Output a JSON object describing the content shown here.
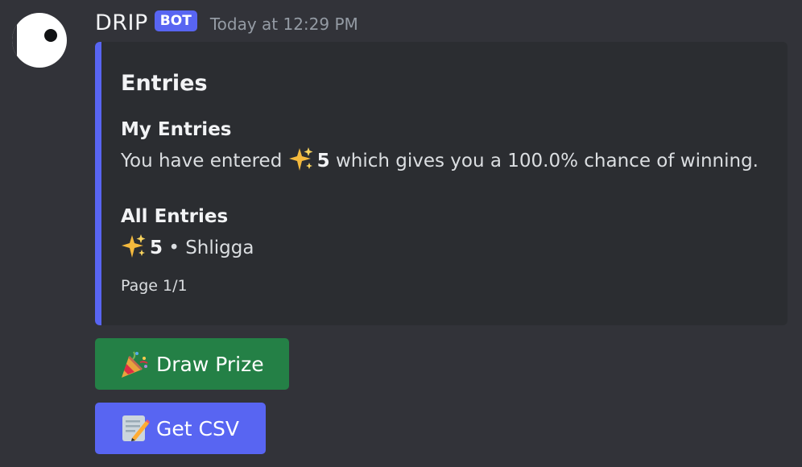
{
  "message": {
    "author": "DRIP",
    "bot_tag": "BOT",
    "timestamp": "Today at 12:29 PM"
  },
  "embed": {
    "title": "Entries",
    "accent_color": "#5865f2",
    "my_entries": {
      "name": "My Entries",
      "prefix": "You have entered",
      "amount": "5",
      "suffix": "which gives you a 100.0% chance of winning."
    },
    "all_entries": {
      "name": "All Entries",
      "amount": "5",
      "user": "• Shligga"
    },
    "footer": "Page 1/1"
  },
  "buttons": {
    "draw": {
      "label": "Draw Prize",
      "icon": "party-popper-icon",
      "color": "#248046"
    },
    "csv": {
      "label": "Get CSV",
      "icon": "memo-icon",
      "color": "#5865f2"
    }
  }
}
